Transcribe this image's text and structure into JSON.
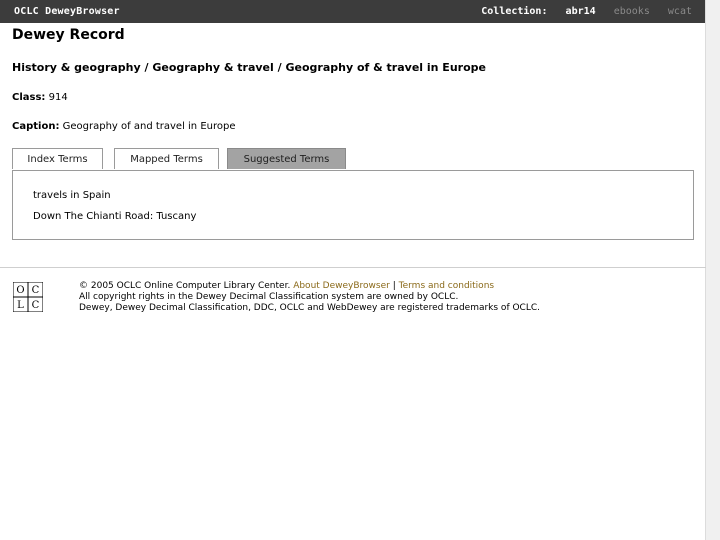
{
  "topbar": {
    "brand": "OCLC DeweyBrowser",
    "collection_label": "Collection:",
    "collection_active": "abr14",
    "collection_options": [
      "ebooks",
      "wcat"
    ]
  },
  "record": {
    "title": "Dewey Record",
    "breadcrumb": [
      "History & geography",
      "Geography & travel",
      "Geography of & travel in Europe"
    ],
    "breadcrumb_sep": " / ",
    "class_label": "Class:",
    "class_value": "914",
    "caption_label": "Caption:",
    "caption_value": "Geography of and travel in Europe"
  },
  "tabs": [
    {
      "label": "Index Terms",
      "active": false
    },
    {
      "label": "Mapped Terms",
      "active": false
    },
    {
      "label": "Suggested Terms",
      "active": true
    }
  ],
  "terms": [
    "travels in Spain",
    "Down The Chianti Road: Tuscany"
  ],
  "footer": {
    "copyright": "© 2005 OCLC Online Computer Library Center.",
    "about_link": "About DeweyBrowser",
    "pipe": "|",
    "terms_link": "Terms and conditions",
    "line2": "All copyright rights in the Dewey Decimal Classification system are owned by OCLC.",
    "line3": "Dewey, Dewey Decimal Classification, DDC, OCLC and WebDewey are registered trademarks of OCLC.",
    "logo_text": "OCLC"
  },
  "colors": {
    "topbar_bg": "#3c3c3c",
    "active_tab_bg": "#a3a3a3",
    "link": "#8b6a1a"
  }
}
